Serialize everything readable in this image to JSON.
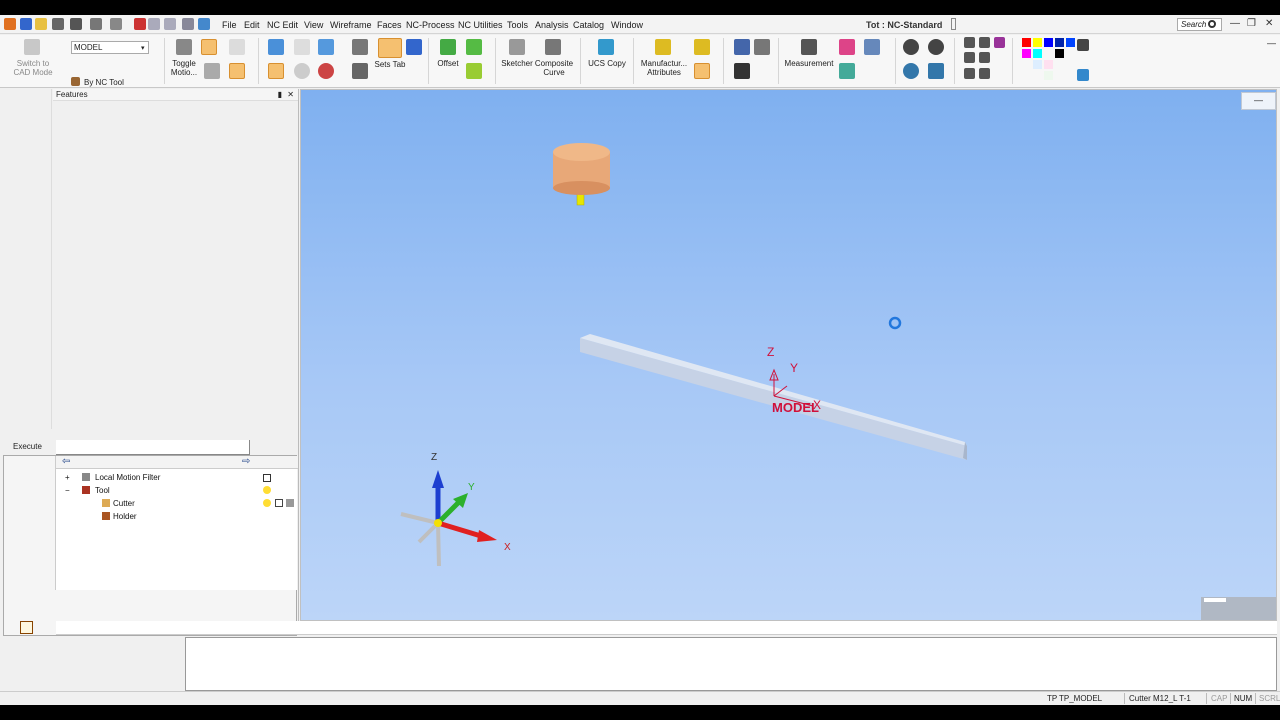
{
  "titlebar": {
    "menu": [
      "File",
      "Edit",
      "NC Edit",
      "View",
      "Wireframe",
      "Faces",
      "NC-Process",
      "NC Utilities",
      "Tools",
      "Analysis",
      "Catalog",
      "Window"
    ],
    "doc_title": "Tot : NC-Standard",
    "search_placeholder": "Search"
  },
  "ribbon": {
    "switch_label": "Switch to CAD Mode",
    "model_combo": "MODEL",
    "by_nc_tool": "By NC Tool",
    "toggle_motion": "Toggle Motio...",
    "sets_tab": "Sets Tab",
    "offset": "Offset",
    "sketcher": "Sketcher",
    "composite_curve": "Composite Curve",
    "ucs_copy": "UCS Copy",
    "manufacturing_attributes": "Manufactur... Attributes",
    "measurement": "Measurement"
  },
  "left_panel": {
    "features_title": "Features",
    "execute_label": "Execute",
    "tree": {
      "local_motion_filter": "Local Motion Filter",
      "tool": "Tool",
      "cutter": "Cutter",
      "holder": "Holder"
    }
  },
  "viewport": {
    "ucs_label": "MODEL",
    "ucs_axes": {
      "z": "Z",
      "y": "Y",
      "x": "X"
    },
    "triad_axes": {
      "z": "Z",
      "y": "Y",
      "x": "X"
    }
  },
  "status_bar": {
    "tp": "TP",
    "tp_model": "TP_MODEL",
    "cutter": "Cutter  M12_L T-1",
    "cap": "CAP",
    "num": "NUM",
    "scrl": "SCRL"
  },
  "colors": {
    "viewport_top": "#7fb0f0",
    "viewport_bottom": "#bcd5f8",
    "ucs_red": "#d0103a",
    "cutter_body": "#e8a878",
    "cutter_shank": "#e6e600"
  }
}
